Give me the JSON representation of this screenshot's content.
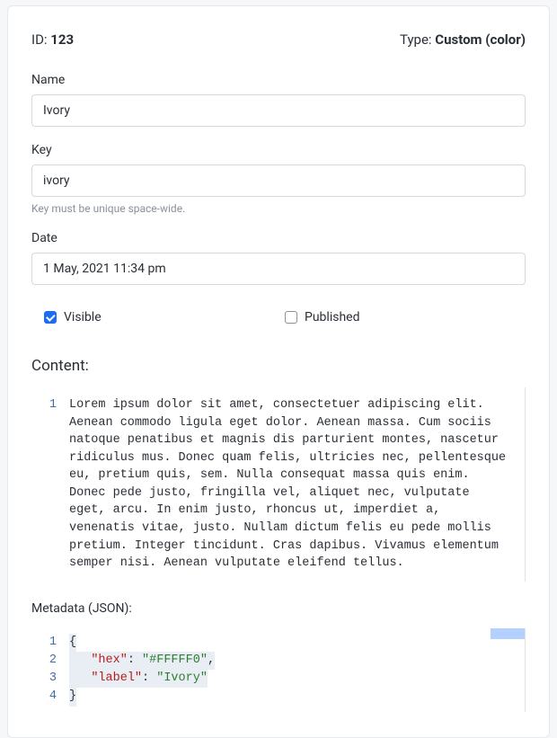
{
  "header": {
    "id_label": "ID: ",
    "id_value": "123",
    "type_label": "Type: ",
    "type_value": "Custom (color)"
  },
  "fields": {
    "name": {
      "label": "Name",
      "value": "Ivory"
    },
    "key": {
      "label": "Key",
      "value": "ivory",
      "helper": "Key must be unique space-wide."
    },
    "date": {
      "label": "Date",
      "value": "1 May, 2021 11:34 pm"
    }
  },
  "checkboxes": {
    "visible": {
      "label": "Visible",
      "checked": true
    },
    "published": {
      "label": "Published",
      "checked": false
    }
  },
  "content": {
    "title": "Content:",
    "line_number": "1",
    "text": "Lorem ipsum dolor sit amet, consectetuer adipiscing elit. Aenean commodo ligula eget dolor. Aenean massa. Cum sociis natoque penatibus et magnis dis parturient montes, nascetur ridiculus mus. Donec quam felis, ultricies nec, pellentesque eu, pretium quis, sem. Nulla consequat massa quis enim. Donec pede justo, fringilla vel, aliquet nec, vulputate eget, arcu. In enim justo, rhoncus ut, imperdiet a, venenatis vitae, justo. Nullam dictum felis eu pede mollis pretium. Integer tincidunt. Cras dapibus. Vivamus elementum semper nisi. Aenean vulputate eleifend tellus."
  },
  "metadata": {
    "title": "Metadata (JSON):",
    "lines": [
      "1",
      "2",
      "3",
      "4"
    ],
    "json": {
      "open": "{",
      "row1_key": "\"hex\"",
      "row1_colon": ": ",
      "row1_val": "\"#FFFFF0\"",
      "row1_comma": ",",
      "row2_key": "\"label\"",
      "row2_colon": ": ",
      "row2_val": "\"Ivory\"",
      "close": "}"
    }
  }
}
